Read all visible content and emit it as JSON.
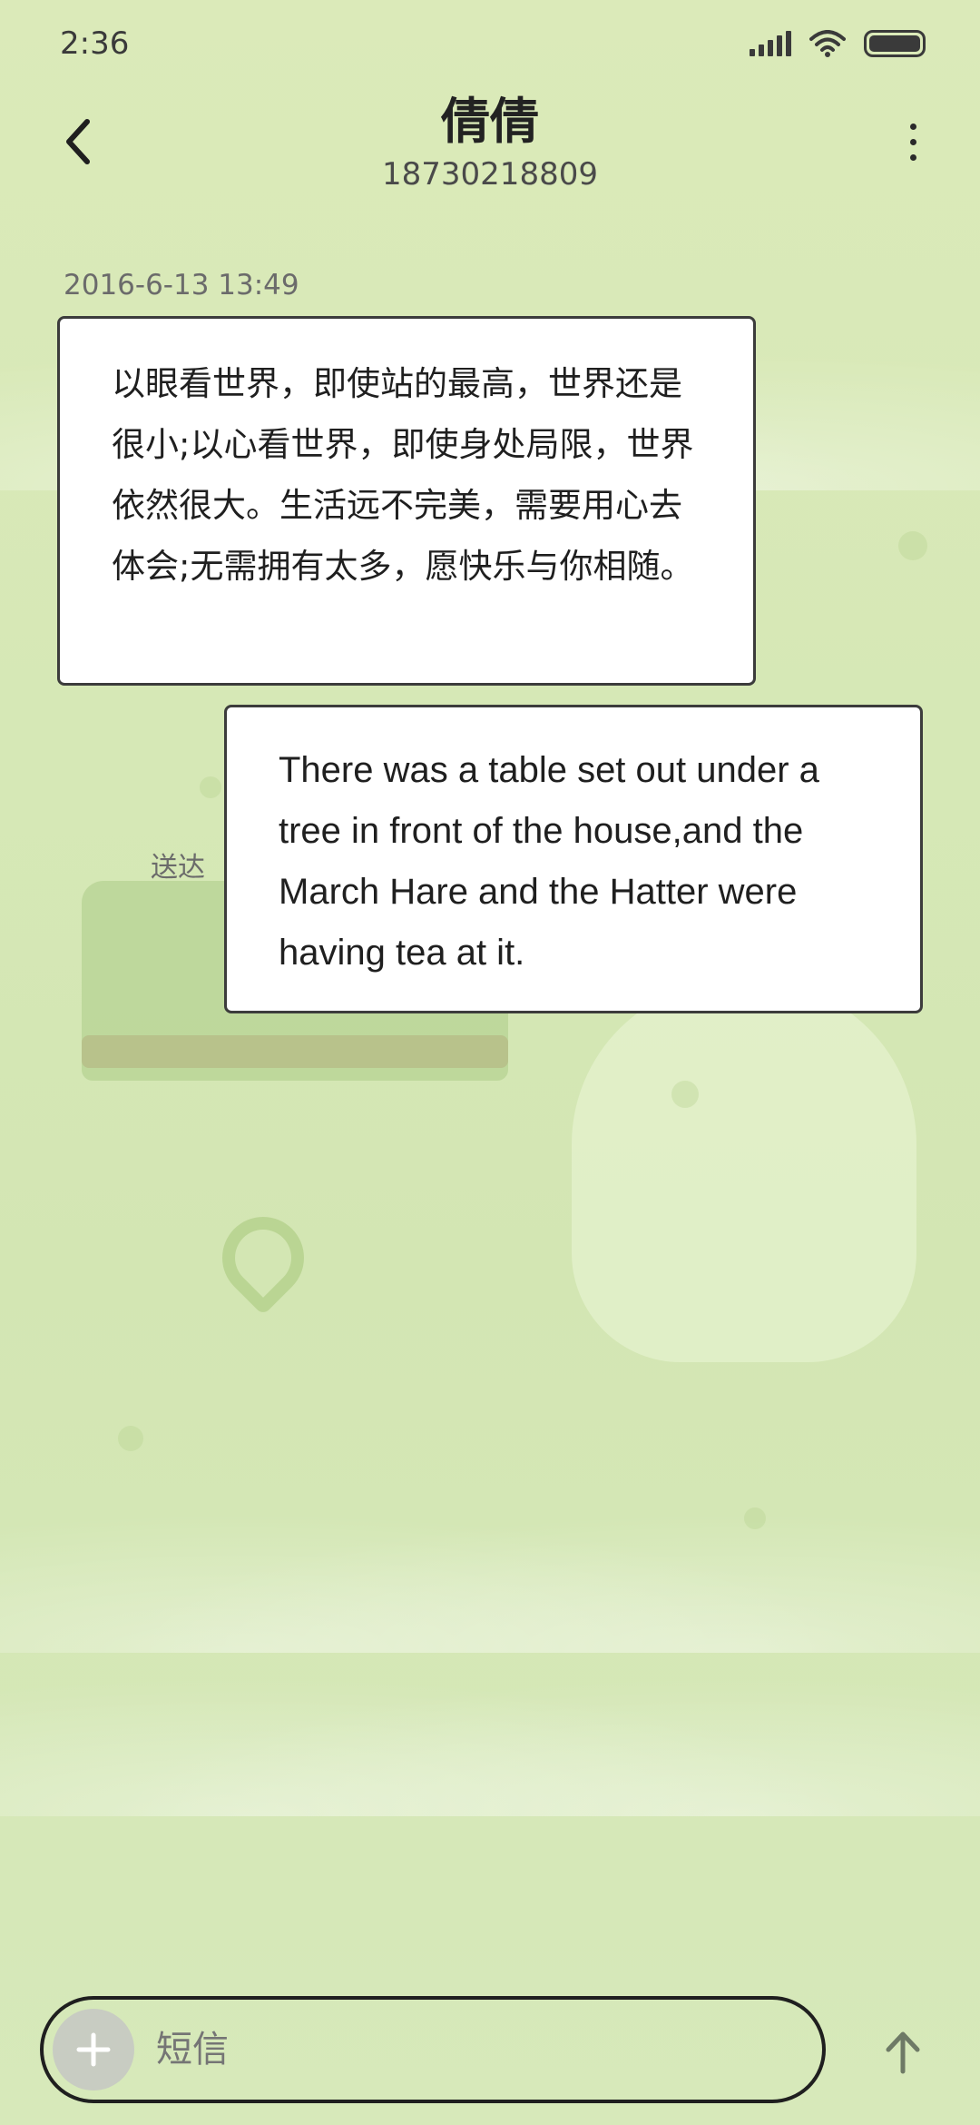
{
  "status_bar": {
    "time": "2:36",
    "signal_icon": "signal-icon",
    "wifi_icon": "wifi-icon",
    "battery_icon": "battery-icon"
  },
  "header": {
    "contact_name": "倩倩",
    "phone_number": "18730218809",
    "back_icon": "back-arrow-icon",
    "more_icon": "more-vertical-icon"
  },
  "conversation": {
    "timestamp": "2016-6-13 13:49",
    "messages": [
      {
        "direction": "incoming",
        "text": "以眼看世界，即使站的最高，世界还是很小;以心看世界，即使身处局限，世界依然很大。生活远不完美，需要用心去体会;无需拥有太多，愿快乐与你相随。"
      },
      {
        "direction": "outgoing",
        "text": "There was a table set out under a tree in front of the house,and the March Hare and the Hatter were having tea at it.",
        "status": "送达"
      }
    ]
  },
  "composer": {
    "placeholder": "短信",
    "add_icon": "plus-icon",
    "send_icon": "send-arrow-icon"
  },
  "colors": {
    "background": "#d6e8b6",
    "bubble": "#ffffff",
    "bubble_border": "#3c3c3c",
    "text_primary": "#1f1f1f",
    "text_secondary": "#6b6b6b"
  }
}
